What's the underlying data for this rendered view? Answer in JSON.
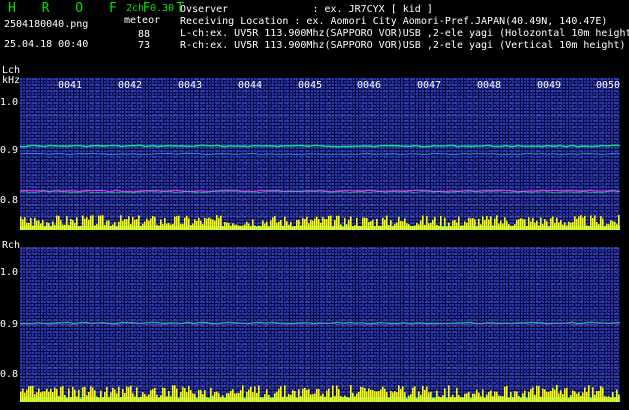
{
  "header": {
    "app_title": "H R O F F T",
    "file_name": "2504180040.png",
    "datetime": "25.04.18 00:40",
    "channel_mode": "2ch 0.30",
    "meteor_label": "meteor",
    "count_l": "88",
    "count_r": "73"
  },
  "info": {
    "line1": "Ovserver              : ex. JR7CYX [ kid ]",
    "line2": "Receiving Location : ex. Aomori City Aomori-Pref.JAPAN(40.49N, 140.47E)",
    "line3": "L-ch:ex. UV5R 113.900Mhz(SAPPORO VOR)USB ,2-ele yagi (Holozontal 10m height)",
    "line4": "R-ch:ex. UV5R 113.900Mhz(SAPPORO VOR)USB ,2-ele yagi (Vertical 10m height)"
  },
  "lch": {
    "label": "Lch",
    "unit": "kHz",
    "ticks": [
      "1.0",
      "0.9",
      "0.8"
    ]
  },
  "rch": {
    "label": "Rch",
    "ticks": [
      "1.0",
      "0.9",
      "0.8"
    ]
  },
  "time_labels": [
    "0041",
    "0042",
    "0043",
    "0044",
    "0045",
    "0046",
    "0047",
    "0048",
    "0049",
    "0050"
  ],
  "colors": {
    "title": "#00e000",
    "signal": "#00ff88",
    "carrier": "#ff40ff",
    "bars": "#ffff00",
    "base": "#00e8ff"
  }
}
